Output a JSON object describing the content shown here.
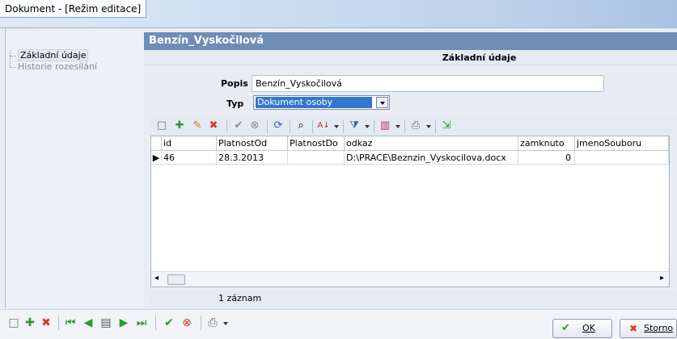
{
  "window": {
    "title": "Dokument - [Režim editace]"
  },
  "sidebar": {
    "items": [
      {
        "label": "Základní údaje"
      },
      {
        "label": "Historie rozesílání"
      }
    ]
  },
  "header": {
    "title": "Benzín_Vyskočilová",
    "section": "Základní údaje"
  },
  "form": {
    "popis_label": "Popis",
    "popis_value": "Benzín_Vyskočilová",
    "typ_label": "Typ",
    "typ_value": "Dokument osoby"
  },
  "toolbar_icons": [
    "new-doc-icon",
    "add-icon",
    "edit-icon",
    "delete-icon",
    "cancel-icon",
    "delete-circle-icon",
    "refresh-icon",
    "find-icon",
    "sort-icon",
    "filter-icon",
    "columns-icon",
    "print-icon",
    "export-icon"
  ],
  "grid": {
    "columns": [
      "id",
      "PlatnostOd",
      "PlatnostDo",
      "odkaz",
      "zamknuto",
      "jmenoSouboru"
    ],
    "rows": [
      {
        "id": "46",
        "PlatnostOd": "28.3.2013",
        "PlatnostDo": "",
        "odkaz": "D:\\PRACE\\Beznzin_Vyskocilova.docx",
        "zamknuto": "0",
        "jmenoSouboru": ""
      }
    ]
  },
  "footer": {
    "count": "1 záznam"
  },
  "buttons": {
    "ok": "OK",
    "storno": "Storno"
  },
  "colors": {
    "header": "#6e8db7",
    "selection": "#3476cc"
  }
}
